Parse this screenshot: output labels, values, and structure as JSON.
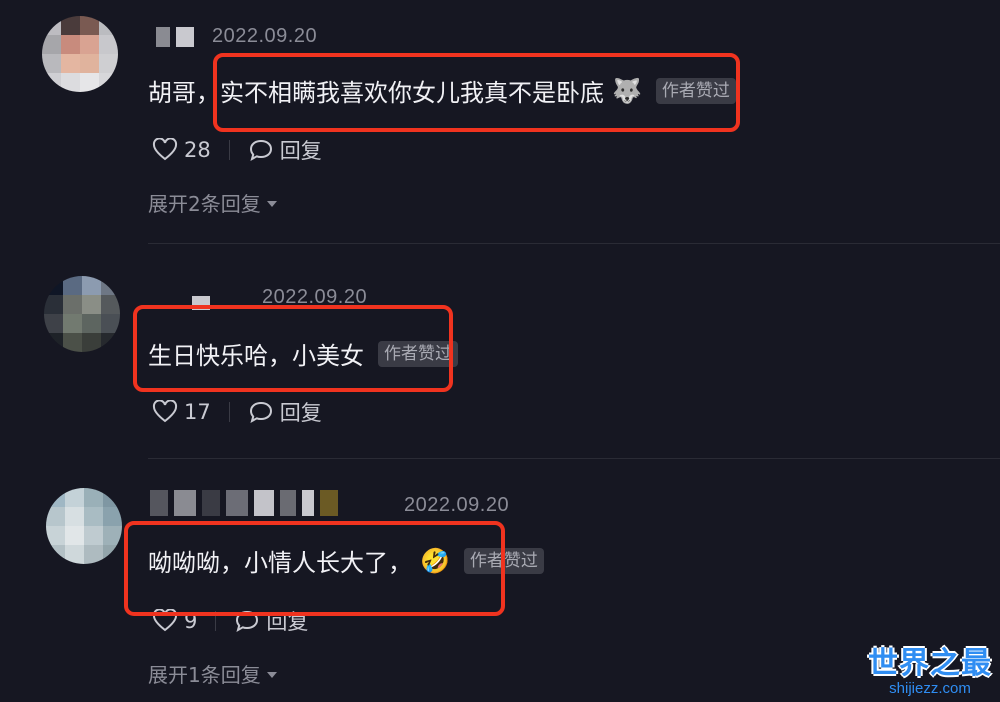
{
  "comments": [
    {
      "date": "2022.09.20",
      "text": "胡哥，实不相瞒我喜欢你女儿我真不是卧底",
      "emoji": "🐺",
      "badge": "作者赞过",
      "likes": "28",
      "reply_label": "回复",
      "expand": "展开2条回复"
    },
    {
      "date": "2022.09.20",
      "text": "生日快乐哈，小美女",
      "badge": "作者赞过",
      "likes": "17",
      "reply_label": "回复"
    },
    {
      "date": "2022.09.20",
      "text": "呦呦呦，小情人长大了，",
      "emoji": "🤣",
      "badge": "作者赞过",
      "likes": "9",
      "reply_label": "回复",
      "expand": "展开1条回复"
    }
  ],
  "watermark": {
    "title": "世界之最",
    "url": "shijiezz.com"
  },
  "colors": {
    "background": "#161722",
    "highlight": "#f0331f",
    "watermark": "#2f8df2"
  }
}
